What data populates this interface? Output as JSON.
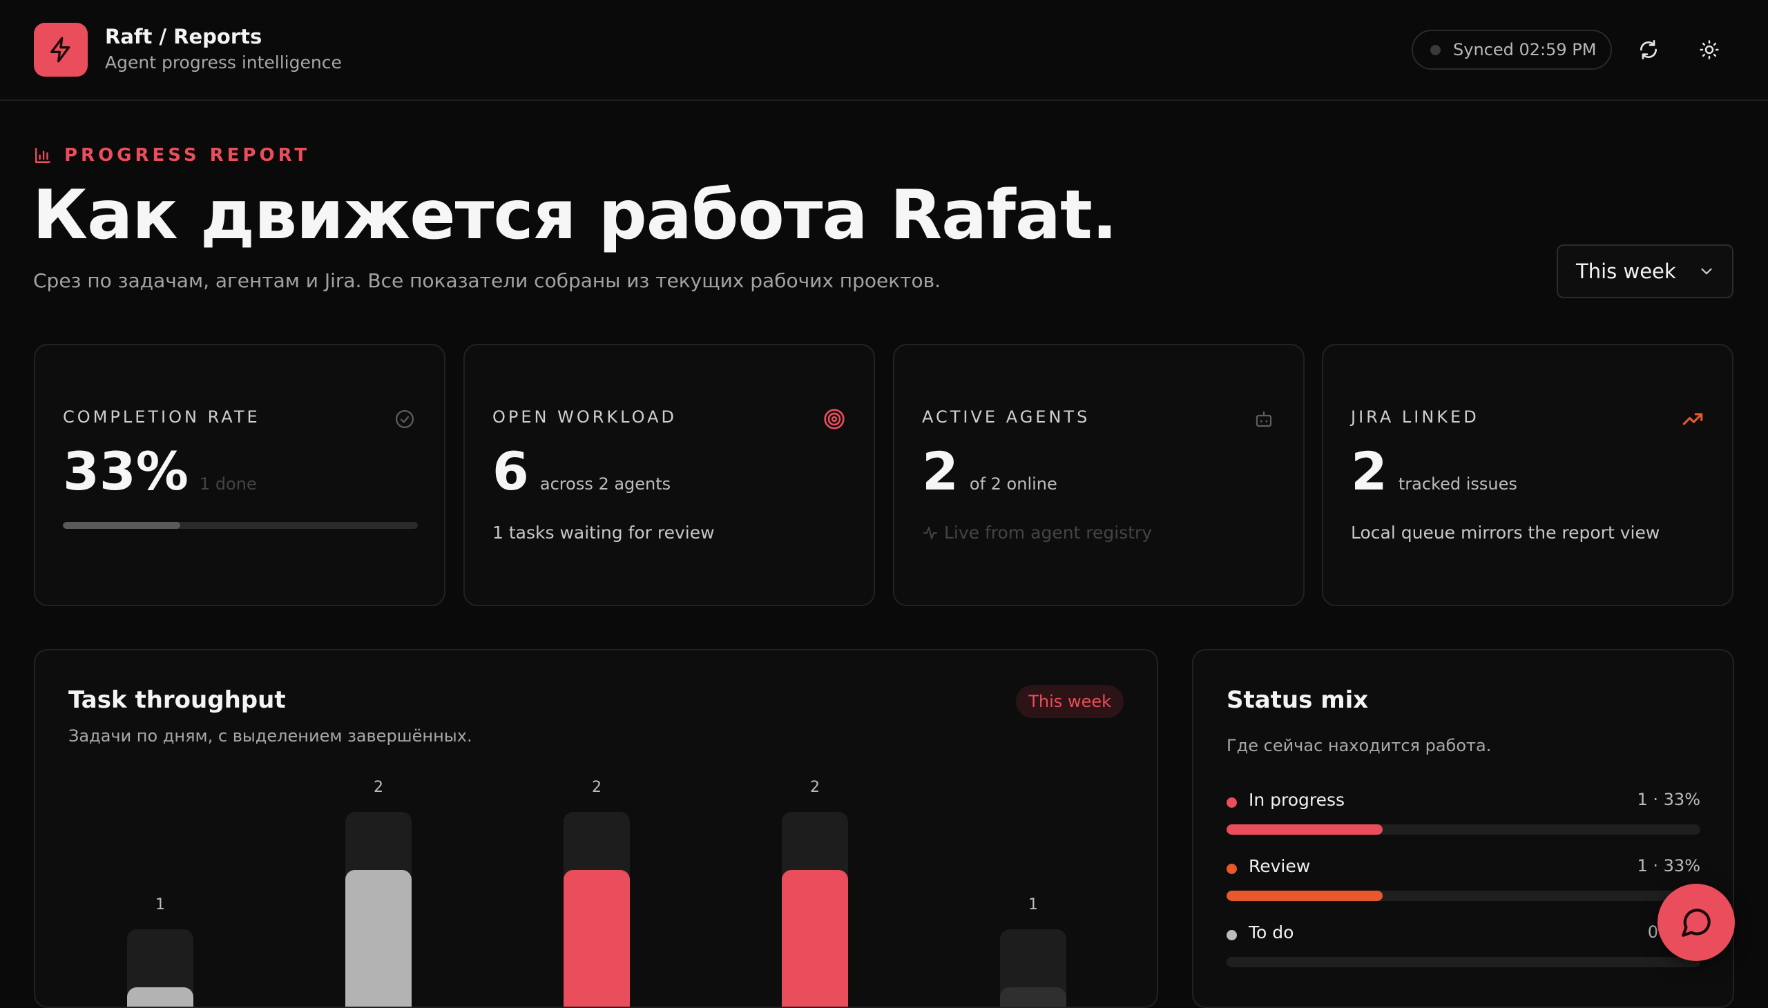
{
  "app": {
    "title": "Raft / Reports",
    "subtitle": "Agent progress intelligence"
  },
  "header": {
    "sync_status": "Synced 02:59 PM",
    "icons": [
      "zap-icon",
      "refresh-icon",
      "sun-icon"
    ]
  },
  "hero": {
    "eyebrow": "PROGRESS REPORT",
    "title": "Как движется работа Rafat.",
    "subtitle": "Срез по задачам, агентам и Jira. Все показатели собраны из текущих рабочих проектов.",
    "range_selected": "This week"
  },
  "kpis": [
    {
      "label": "COMPLETION RATE",
      "value": "33%",
      "unit": "1 done",
      "progress": 0.33,
      "icon": "check-circle-icon"
    },
    {
      "label": "OPEN WORKLOAD",
      "value": "6",
      "unit": "across 2 agents",
      "note": "1 tasks waiting for review",
      "icon": "target-icon"
    },
    {
      "label": "ACTIVE AGENTS",
      "value": "2",
      "unit": "of 2 online",
      "note": "Live from agent registry",
      "icon": "bot-icon"
    },
    {
      "label": "JIRA LINKED",
      "value": "2",
      "unit": "tracked issues",
      "note": "Local queue mirrors the report view",
      "icon": "trending-up-icon"
    }
  ],
  "throughput": {
    "title": "Task throughput",
    "subtitle": "Задачи по дням, с выделением завершённых.",
    "badge": "This week"
  },
  "chart_data": {
    "type": "bar",
    "series": [
      {
        "values": [
          1,
          2,
          2,
          2,
          1
        ]
      }
    ],
    "highlight_colors": [
      "#b3b3b3",
      "#b3b3b3",
      "#ea4d5b",
      "#ea4d5b",
      "#2f2f2f"
    ],
    "data_labels": [
      "1",
      "2",
      "2",
      "2",
      "1"
    ]
  },
  "status_mix": {
    "title": "Status mix",
    "subtitle": "Где сейчас находится работа.",
    "items": [
      {
        "name": "In progress",
        "value": "1 · 33%",
        "fraction": 0.33,
        "color": "#ea4d5b"
      },
      {
        "name": "Review",
        "value": "1 · 33%",
        "fraction": 0.33,
        "color": "#e8582c"
      },
      {
        "name": "To do",
        "value": "0 · 0%",
        "fraction": 0,
        "color": "#bdbdbd"
      }
    ]
  }
}
